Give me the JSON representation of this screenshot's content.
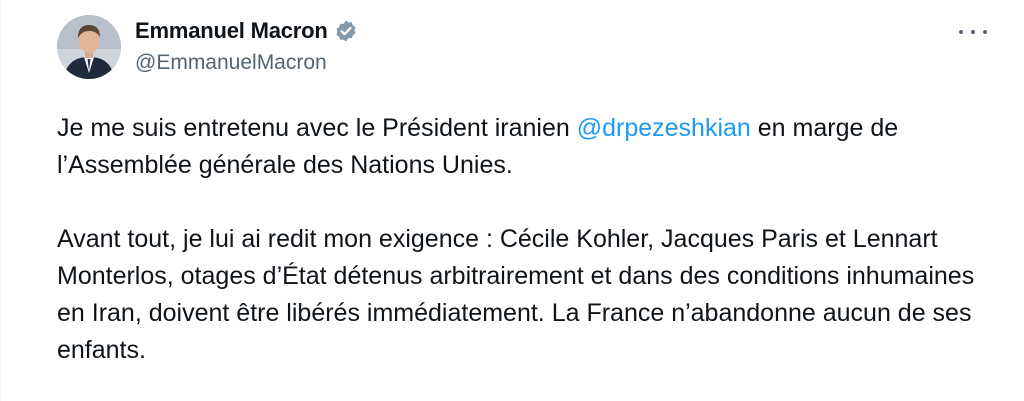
{
  "author": {
    "name": "Emmanuel Macron",
    "handle": "@EmmanuelMacron",
    "verified_icon": "verified-badge-icon",
    "badge_color": "#829aab"
  },
  "menu_icon": "more-options-icon",
  "tweet": {
    "p1_before": "Je me suis entretenu avec le Président iranien ",
    "p1_mention": "@drpezeshkian",
    "p1_after": " en marge de l’Assemblée générale des Nations Unies.",
    "p2": "Avant tout, je lui ai redit mon exigence : Cécile Kohler, Jacques Paris et Lennart Monterlos, otages d’État détenus arbitrairement et dans des conditions inhumaines en Iran, doivent être libérés immédiatement. La France n’abandonne aucun de ses enfants."
  },
  "colors": {
    "text": "#0f1419",
    "secondary": "#536471",
    "link": "#1d9bf0"
  }
}
